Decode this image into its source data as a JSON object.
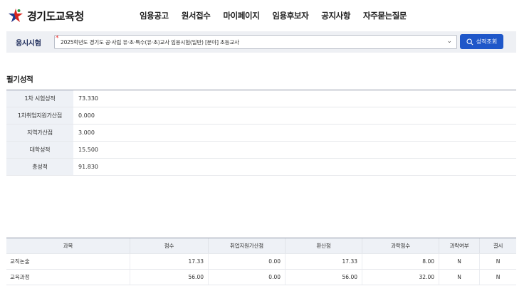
{
  "header": {
    "logo_text": "경기도교육청",
    "nav": [
      "임용공고",
      "원서접수",
      "마이페이지",
      "임용후보자",
      "공지사항",
      "자주묻는질문"
    ]
  },
  "exam_bar": {
    "label": "응시시험",
    "required_mark": "*",
    "selected_exam": "2025학년도 경기도 공·사립 유·초·특수(유·초)교사 임용시험(일반) [분야] 초등교사",
    "search_button": "성적조회"
  },
  "written": {
    "title": "필기성적",
    "rows": [
      {
        "label": "1차 시험성적",
        "value": "73.330"
      },
      {
        "label": "1차취업지원가산점",
        "value": "0.000"
      },
      {
        "label": "지역가산점",
        "value": "3.000"
      },
      {
        "label": "대학성적",
        "value": "15.500"
      },
      {
        "label": "총성적",
        "value": "91.830"
      }
    ]
  },
  "subjects": {
    "headers": [
      "과목",
      "점수",
      "취업지원가산점",
      "환산점",
      "과락점수",
      "과락여부",
      "결시"
    ],
    "rows": [
      [
        "교직논술",
        "17.33",
        "0.00",
        "17.33",
        "8.00",
        "N",
        "N"
      ],
      [
        "교육과정",
        "56.00",
        "0.00",
        "56.00",
        "32.00",
        "N",
        "N"
      ]
    ]
  },
  "colors": {
    "primary_button": "#1f57c9",
    "bar_background": "#eef0f4",
    "header_cell": "#eef1f6",
    "logo_red": "#d7261e",
    "logo_blue": "#1b3f95"
  }
}
